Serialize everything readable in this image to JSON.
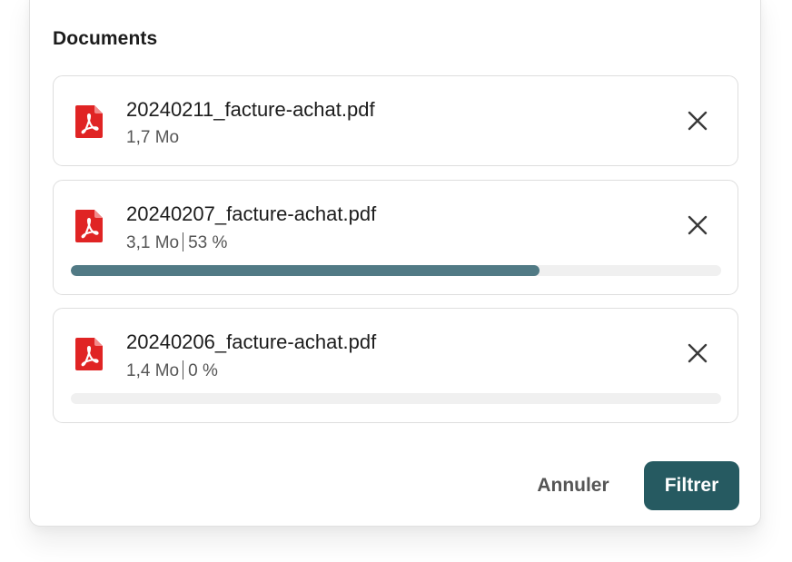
{
  "section": {
    "title": "Documents"
  },
  "files": [
    {
      "name": "20240211_facture-achat.pdf",
      "size": "1,7 Mo",
      "progress_text": "",
      "progress": null,
      "icon": "pdf-icon",
      "remove_icon": "close-icon"
    },
    {
      "name": "20240207_facture-achat.pdf",
      "size": "3,1 Mo",
      "progress_text": "53 %",
      "progress": 0.72,
      "icon": "pdf-icon",
      "remove_icon": "close-icon"
    },
    {
      "name": "20240206_facture-achat.pdf",
      "size": "1,4 Mo",
      "progress_text": "0 %",
      "progress": 0,
      "icon": "pdf-icon",
      "remove_icon": "close-icon"
    }
  ],
  "actions": {
    "cancel_label": "Annuler",
    "filter_label": "Filtrer"
  },
  "colors": {
    "pdf_red": "#e02424",
    "progress_fill": "#517a85",
    "progress_track": "#f0f0f0",
    "primary_button": "#265a61"
  }
}
